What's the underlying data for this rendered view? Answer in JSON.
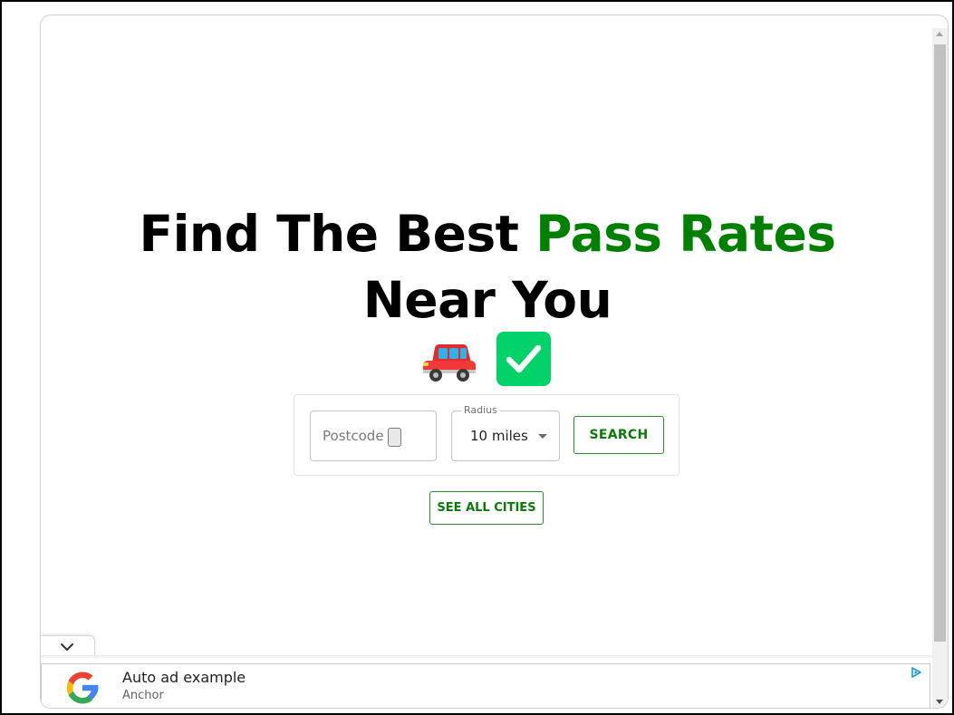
{
  "hero": {
    "title_line1_prefix": "Find The Best ",
    "title_line1_accent": "Pass Rates",
    "title_line2": "Near You",
    "emojis": [
      "car-icon",
      "check-mark-icon"
    ]
  },
  "search": {
    "postcode_placeholder": "Postcode",
    "radius_label": "Radius",
    "radius_value": "10 miles",
    "search_label": "SEARCH"
  },
  "see_all_label": "SEE ALL CITIES",
  "ad": {
    "title": "Auto ad example",
    "subtitle": "Anchor"
  },
  "colors": {
    "accent": "#008000",
    "button_border": "#2e8b2e",
    "check_green": "#00D26A"
  }
}
